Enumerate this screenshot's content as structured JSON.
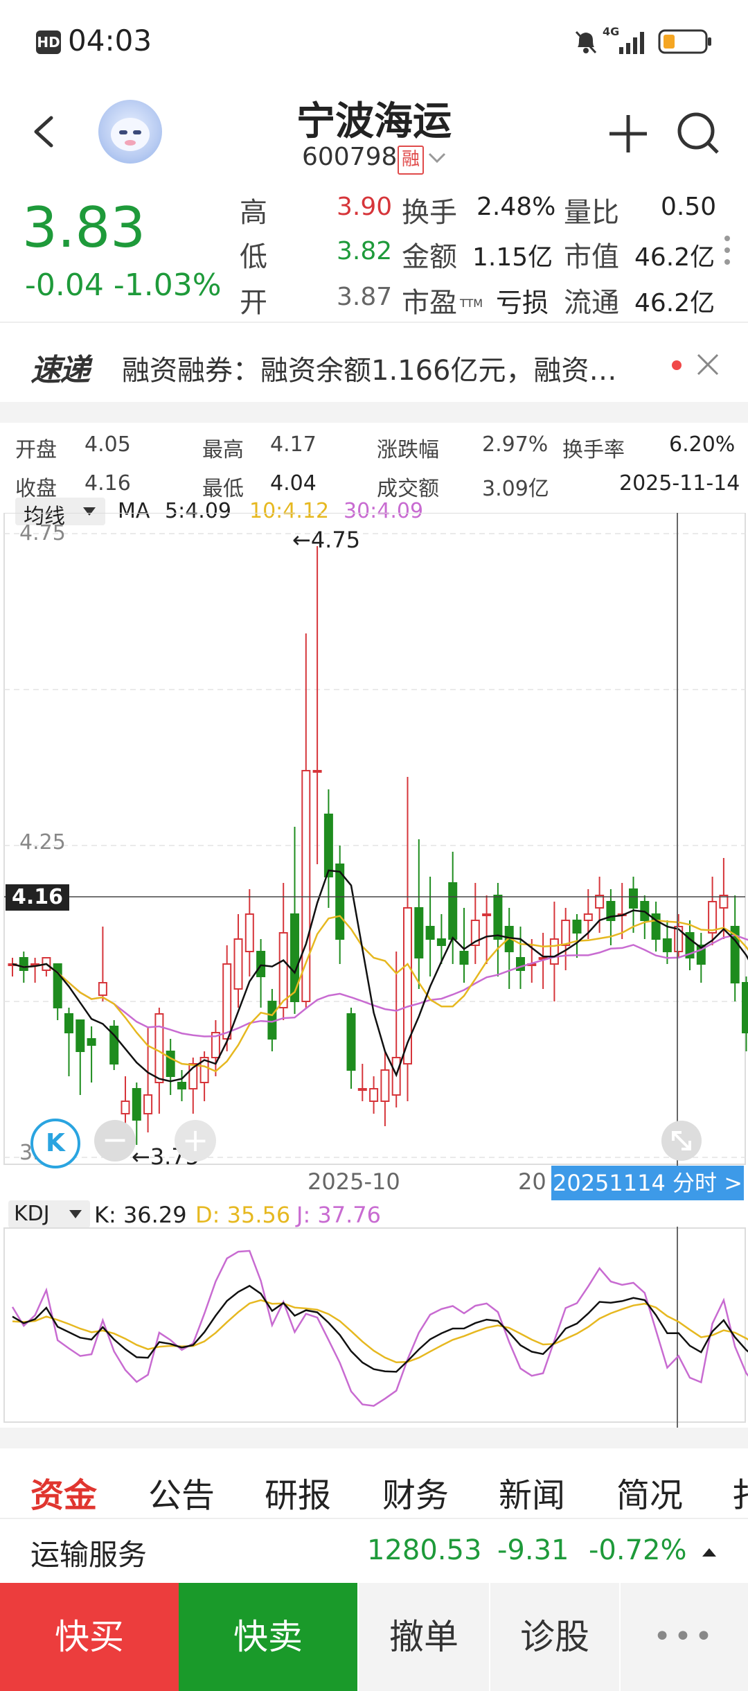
{
  "status": {
    "hd": "HD",
    "time": "04:03",
    "network": "4G"
  },
  "header": {
    "name": "宁波海运",
    "code": "600798",
    "margin_badge": "融"
  },
  "quote": {
    "price": "3.83",
    "change": "-0.04",
    "change_pct": "-1.03%",
    "rows": [
      {
        "l1": "高",
        "v1": "3.90",
        "l2": "换手",
        "v2": "2.48%",
        "l3": "量比",
        "v3": "0.50"
      },
      {
        "l1": "低",
        "v1": "3.82",
        "l2": "金额",
        "v2": "1.15亿",
        "l3": "市值",
        "v3": "46.2亿"
      },
      {
        "l1": "开",
        "v1": "3.87",
        "l2": "市盈",
        "v2": "亏损",
        "l3": "流通",
        "v3": "46.2亿"
      }
    ],
    "pe_sub": "TTM"
  },
  "news": {
    "badge": "速递",
    "text": "融资融券：融资余额1.166亿元，融资…"
  },
  "day_info": {
    "open_l": "开盘",
    "open_v": "4.05",
    "high_l": "最高",
    "high_v": "4.17",
    "pct_l": "涨跌幅",
    "pct_v": "2.97%",
    "turn_l": "换手率",
    "turn_v": "6.20%",
    "close_l": "收盘",
    "close_v": "4.16",
    "low_l": "最低",
    "low_v": "4.04",
    "amt_l": "成交额",
    "amt_v": "3.09亿",
    "date": "2025-11-14"
  },
  "ma": {
    "selector": "均线",
    "label": "MA",
    "ma5": "5:4.09",
    "ma10": "10:4.12",
    "ma30": "30:4.09"
  },
  "chart_data": {
    "type": "candlestick",
    "ylim": [
      3.75,
      4.75
    ],
    "y_ticks": [
      "4.75",
      "4.25",
      "3.75"
    ],
    "cursor_price": "4.16",
    "max_label": "4.75",
    "min_label": "3.75",
    "x_tick": "2025-10",
    "cursor_tag": "20251114 分时 >",
    "candles": [
      [
        4.06,
        4.06,
        4.07,
        4.04
      ],
      [
        4.07,
        4.05,
        4.08,
        4.03
      ],
      [
        4.06,
        4.06,
        4.07,
        4.03
      ],
      [
        4.05,
        4.07,
        4.07,
        4.04
      ],
      [
        4.06,
        3.99,
        4.06,
        3.97
      ],
      [
        3.98,
        3.95,
        3.99,
        3.88
      ],
      [
        3.97,
        3.92,
        3.97,
        3.85
      ],
      [
        3.94,
        3.93,
        3.96,
        3.87
      ],
      [
        4.01,
        4.03,
        4.12,
        4.0
      ],
      [
        3.96,
        3.9,
        3.97,
        3.89
      ],
      [
        3.82,
        3.84,
        3.88,
        3.79
      ],
      [
        3.86,
        3.81,
        3.87,
        3.77
      ],
      [
        3.82,
        3.85,
        3.96,
        3.79
      ],
      [
        3.87,
        3.98,
        3.99,
        3.82
      ],
      [
        3.92,
        3.88,
        3.94,
        3.85
      ],
      [
        3.87,
        3.86,
        3.89,
        3.84
      ],
      [
        3.86,
        3.9,
        3.91,
        3.82
      ],
      [
        3.87,
        3.91,
        3.92,
        3.84
      ],
      [
        3.91,
        3.95,
        3.97,
        3.88
      ],
      [
        3.94,
        4.06,
        4.09,
        3.92
      ],
      [
        4.02,
        4.1,
        4.14,
        3.99
      ],
      [
        4.08,
        4.14,
        4.18,
        4.04
      ],
      [
        4.08,
        4.04,
        4.1,
        3.99
      ],
      [
        4.0,
        3.94,
        4.02,
        3.92
      ],
      [
        3.99,
        4.11,
        4.19,
        3.97
      ],
      [
        4.14,
        4.0,
        4.28,
        3.98
      ],
      [
        4.0,
        4.37,
        4.59,
        3.99
      ],
      [
        4.37,
        4.37,
        4.73,
        4.22
      ],
      [
        4.3,
        4.2,
        4.34,
        4.15
      ],
      [
        4.22,
        4.1,
        4.25,
        4.06
      ],
      [
        3.98,
        3.89,
        3.99,
        3.86
      ],
      [
        3.86,
        3.86,
        3.9,
        3.84
      ],
      [
        3.84,
        3.86,
        3.88,
        3.82
      ],
      [
        3.84,
        3.89,
        3.92,
        3.8
      ],
      [
        3.85,
        3.91,
        4.08,
        3.83
      ],
      [
        3.9,
        4.15,
        4.36,
        3.84
      ],
      [
        4.15,
        4.07,
        4.26,
        4.02
      ],
      [
        4.12,
        4.1,
        4.2,
        4.04
      ],
      [
        4.1,
        4.09,
        4.14,
        4.06
      ],
      [
        4.19,
        4.1,
        4.24,
        4.06
      ],
      [
        4.08,
        4.06,
        4.15,
        4.03
      ],
      [
        4.09,
        4.13,
        4.19,
        4.06
      ],
      [
        4.14,
        4.14,
        4.17,
        4.06
      ],
      [
        4.17,
        4.1,
        4.19,
        4.04
      ],
      [
        4.12,
        4.08,
        4.15,
        4.02
      ],
      [
        4.07,
        4.05,
        4.12,
        4.02
      ],
      [
        4.06,
        4.06,
        4.1,
        4.03
      ],
      [
        4.07,
        4.07,
        4.11,
        4.02
      ],
      [
        4.06,
        4.1,
        4.16,
        4.0
      ],
      [
        4.09,
        4.13,
        4.15,
        4.05
      ],
      [
        4.13,
        4.11,
        4.14,
        4.07
      ],
      [
        4.13,
        4.14,
        4.18,
        4.1
      ],
      [
        4.15,
        4.17,
        4.2,
        4.11
      ],
      [
        4.16,
        4.13,
        4.18,
        4.09
      ],
      [
        4.14,
        4.14,
        4.19,
        4.1
      ],
      [
        4.18,
        4.15,
        4.2,
        4.11
      ],
      [
        4.16,
        4.13,
        4.17,
        4.1
      ],
      [
        4.14,
        4.1,
        4.16,
        4.08
      ],
      [
        4.1,
        4.08,
        4.13,
        4.06
      ],
      [
        4.08,
        4.12,
        4.14,
        4.07
      ],
      [
        4.11,
        4.07,
        4.13,
        4.05
      ],
      [
        4.09,
        4.06,
        4.11,
        4.03
      ],
      [
        4.11,
        4.16,
        4.2,
        4.09
      ],
      [
        4.15,
        4.17,
        4.23,
        4.1
      ],
      [
        4.12,
        4.03,
        4.17,
        4.0
      ],
      [
        4.03,
        3.95,
        4.04,
        3.92
      ],
      [
        3.93,
        3.89,
        3.94,
        3.86
      ],
      [
        3.88,
        3.84,
        3.9,
        3.81
      ]
    ],
    "kdj": {
      "label": "KDJ",
      "k": "K: 36.29",
      "d": "D: 35.56",
      "j": "J: 37.76"
    }
  },
  "tabs": [
    "资金",
    "公告",
    "研报",
    "财务",
    "新闻",
    "简况",
    "扌"
  ],
  "sector": {
    "name": "运输服务",
    "index": "1280.53",
    "chg": "-9.31",
    "pct": "-0.72%"
  },
  "actions": {
    "buy": "快买",
    "sell": "快卖",
    "cancel": "撤单",
    "diagnose": "诊股",
    "more": "•••"
  },
  "colors": {
    "up": "#d6353a",
    "down": "#1e8c1e",
    "ma5": "#111111",
    "ma10": "#e6b820",
    "ma30": "#c86bd1",
    "buy_bg": "#ec3d3d",
    "sell_bg": "#1a9a2a"
  }
}
